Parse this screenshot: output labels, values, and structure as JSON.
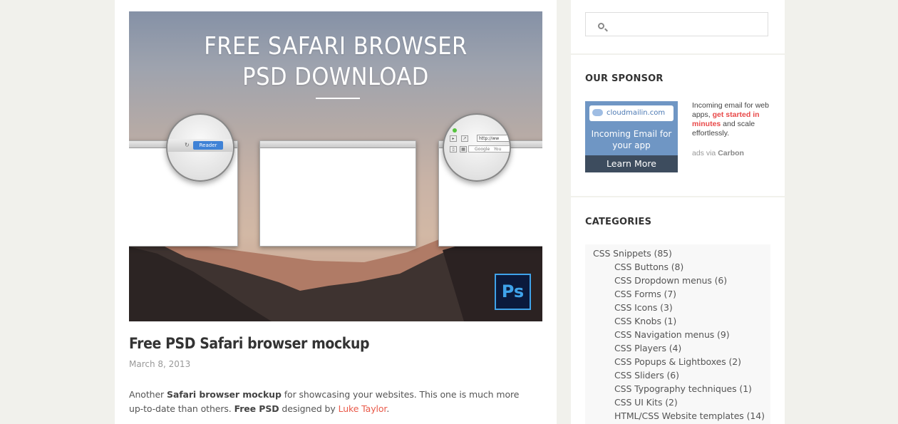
{
  "hero": {
    "title_line1": "FREE SAFARI BROWSER",
    "title_line2": "PSD DOWNLOAD",
    "reader_label": "Reader",
    "url_text": "http://ww",
    "google_text": "Google",
    "you_text": "You",
    "ps_badge": "Ps"
  },
  "post": {
    "title": "Free PSD Safari browser mockup",
    "date": "March 8, 2013",
    "body_1": "Another ",
    "body_bold_1": "Safari browser mockup",
    "body_2": " for showcasing your websites. This one is much more up-to-date than others. ",
    "body_bold_2": "Free PSD",
    "body_3": " designed by ",
    "author_link": "Luke Taylor",
    "body_4": "."
  },
  "search": {
    "placeholder": ""
  },
  "sponsor": {
    "heading": "OUR SPONSOR",
    "ad_logo": "cloudmailin.com",
    "ad_tagline": "Incoming Email for your app",
    "ad_button": "Learn More",
    "ad_text_1": "Incoming email for web apps, ",
    "ad_text_highlight": "get started in minutes",
    "ad_text_2": " and scale effortlessly.",
    "ads_via": "ads via ",
    "ads_via_brand": "Carbon"
  },
  "categories": {
    "heading": "CATEGORIES",
    "items": [
      {
        "label": "CSS Snippets (85)",
        "level": 0
      },
      {
        "label": "CSS Buttons (8)",
        "level": 1
      },
      {
        "label": "CSS Dropdown menus (6)",
        "level": 1
      },
      {
        "label": "CSS Forms (7)",
        "level": 1
      },
      {
        "label": "CSS Icons (3)",
        "level": 1
      },
      {
        "label": "CSS Knobs (1)",
        "level": 1
      },
      {
        "label": "CSS Navigation menus (9)",
        "level": 1
      },
      {
        "label": "CSS Players (4)",
        "level": 1
      },
      {
        "label": "CSS Popups & Lightboxes (2)",
        "level": 1
      },
      {
        "label": "CSS Sliders (6)",
        "level": 1
      },
      {
        "label": "CSS Typography techniques (1)",
        "level": 1
      },
      {
        "label": "CSS UI Kits (2)",
        "level": 1
      },
      {
        "label": "HTML/CSS Website templates (14)",
        "level": 1
      }
    ]
  },
  "colors": {
    "page_bg": "#f1f1ec",
    "link": "#e95a4a",
    "ad_highlight": "#e84848"
  },
  "icons": [
    "search-icon",
    "photoshop-icon",
    "reload-icon"
  ]
}
